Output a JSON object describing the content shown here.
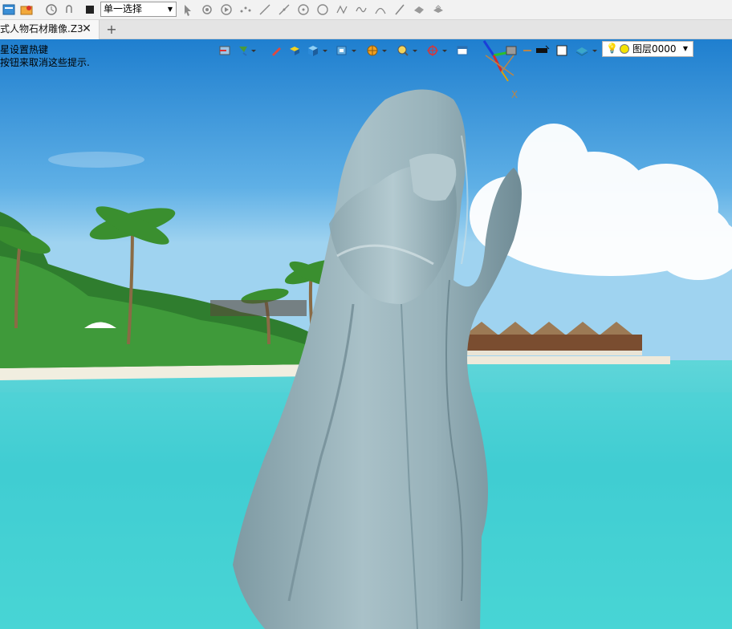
{
  "toolbar": {
    "selection_mode": "单一选择",
    "icons": [
      "app-icon",
      "open-icon",
      "history-icon",
      "undo-icon",
      "stop-icon",
      "cursor-icon",
      "pick-icon",
      "play-icon",
      "points-icon",
      "line-icon",
      "arc-icon",
      "circle-icon",
      "curve-icon",
      "spline-icon",
      "bend-icon",
      "pen-icon",
      "eraser-icon",
      "hand-icon"
    ]
  },
  "tabs": [
    {
      "label": "式人物石材雕像.Z3",
      "close_symbol": "✕",
      "active": true
    }
  ],
  "tab_add_symbol": "+",
  "hints": {
    "line1": "星设置热键",
    "line2": "按钮来取消这些提示."
  },
  "view_toolbar": {
    "layer_label": "图层0000"
  },
  "axis_label": "X",
  "colors": {
    "statue": "#9fb7bf",
    "sky": "#2e8ed6",
    "water": "#3fd0d4"
  }
}
